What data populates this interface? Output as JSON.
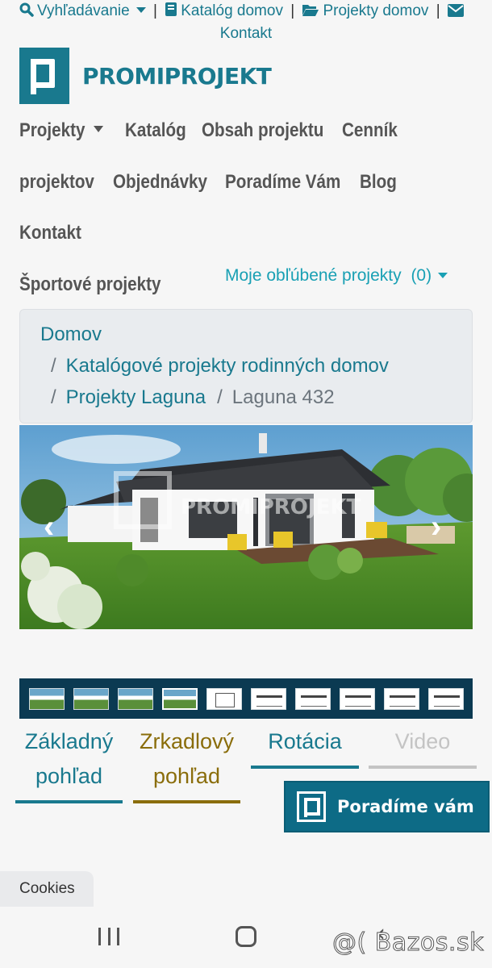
{
  "topbar": {
    "search_label": "Vyhľadávanie",
    "catalog_label": "Katalóg domov",
    "projects_label": "Projekty domov",
    "contact_label": "Kontakt",
    "separator": "|"
  },
  "brand": {
    "name": "PROMIPROJEKT",
    "color": "#19798e"
  },
  "nav": {
    "projekty": "Projekty",
    "katalog": "Katalóg",
    "obsah": "Obsah projektu",
    "cennik_1": "Cenník",
    "cennik_2": "projektov",
    "objednavky": "Objednávky",
    "poradime": "Poradíme Vám",
    "blog": "Blog",
    "kontakt": "Kontakt",
    "sportove": "Športové projekty"
  },
  "favorites": {
    "label": "Moje obľúbené projekty",
    "count": "(0)"
  },
  "breadcrumb": {
    "home": "Domov",
    "catalog": "Katalógové projekty rodinných domov",
    "series": "Projekty Laguna",
    "current": "Laguna 432",
    "separator": "/"
  },
  "gallery": {
    "watermark": "PROMIPROJEKT",
    "prev_glyph": "‹",
    "next_glyph": "›",
    "thumbnails": [
      "photo",
      "photo",
      "photo",
      "photo-selected",
      "floor-plan",
      "section",
      "elevation",
      "elevation",
      "elevation",
      "elevation"
    ]
  },
  "tabs": [
    {
      "line1": "Základný",
      "line2": "pohľad",
      "color": "#19798e"
    },
    {
      "line1": "Zrkadlový",
      "line2": "pohľad",
      "color": "#8a6d0b"
    },
    {
      "line1": "Rotácia",
      "line2": "",
      "color": "#19798e"
    },
    {
      "line1": "Video",
      "line2": "",
      "color": "#c4c4c4"
    }
  ],
  "advise_button": {
    "label": "Poradíme vám",
    "color": "#0d6b86"
  },
  "cookies": {
    "label": "Cookies"
  },
  "watermark_site": "@( Bazos.sk"
}
